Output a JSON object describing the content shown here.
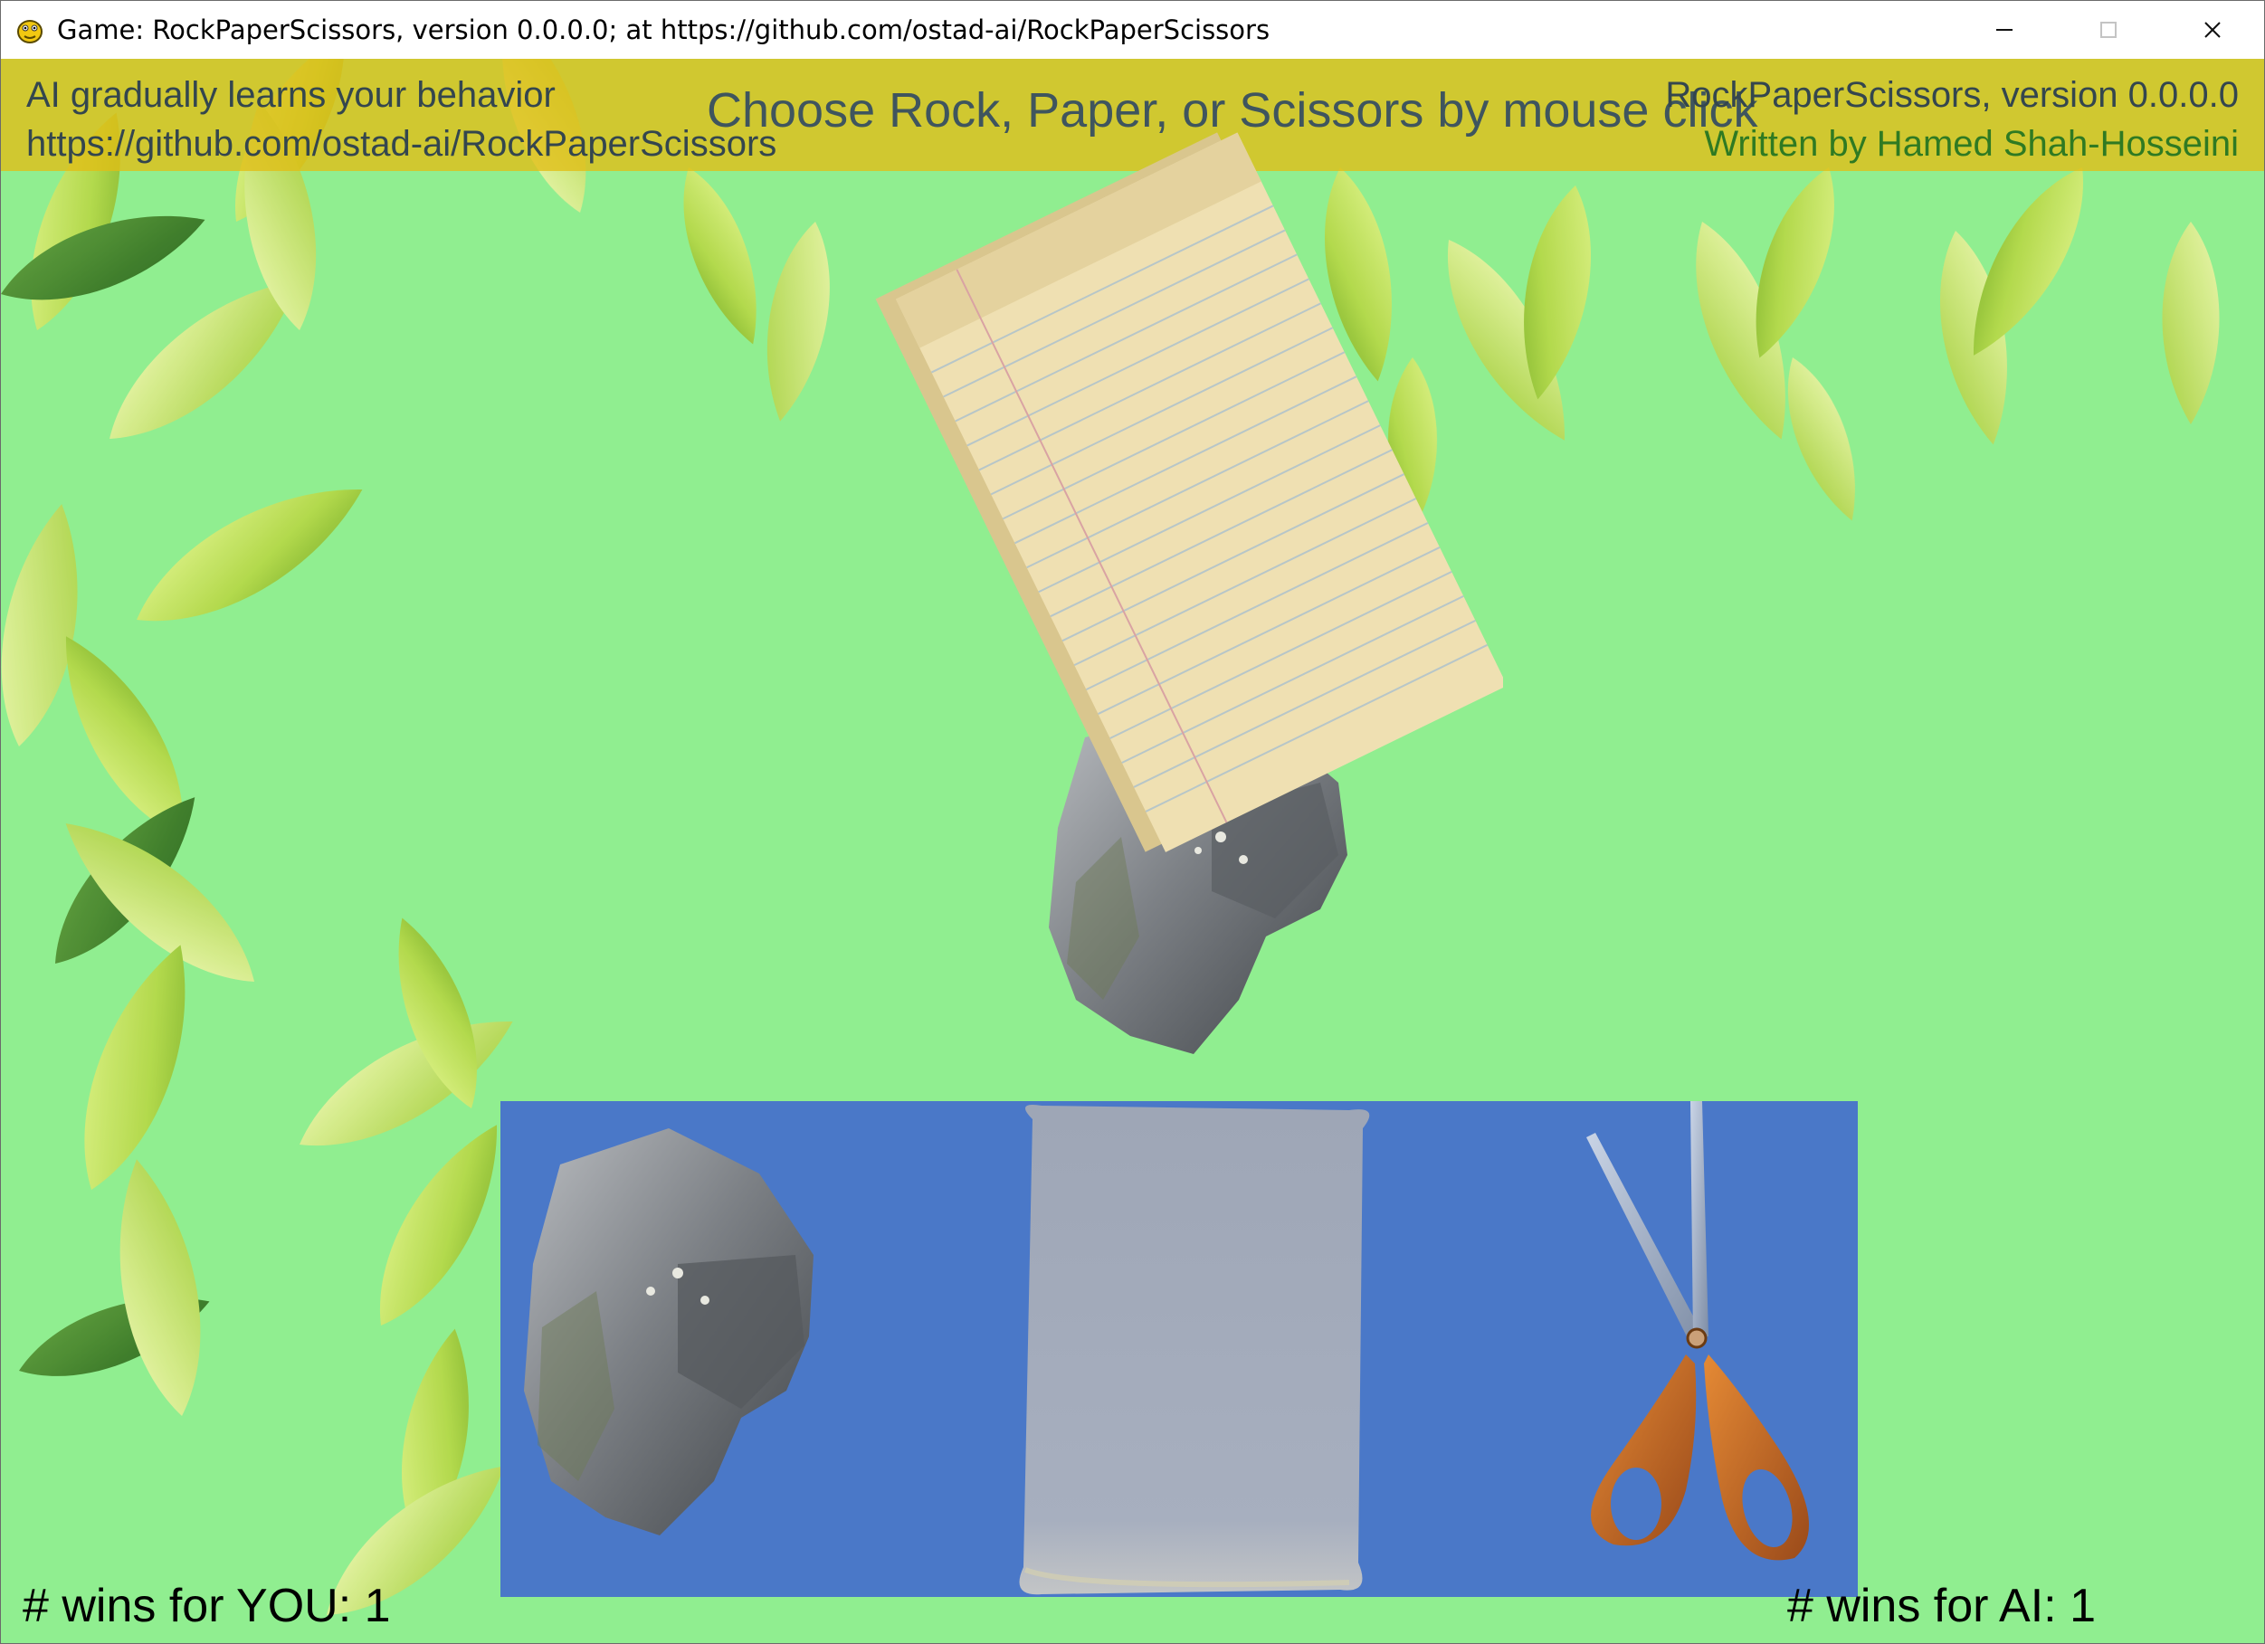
{
  "window": {
    "title": "Game: RockPaperScissors, version 0.0.0.0; at https://github.com/ostad-ai/RockPaperScissors",
    "icon": "pygame-snake-icon",
    "controls": [
      "minimize-icon",
      "maximize-icon",
      "close-icon"
    ]
  },
  "banner": {
    "left_line1": "AI gradually learns your behavior",
    "left_line2": "https://github.com/ostad-ai/RockPaperScissors",
    "center": "Choose Rock, Paper, or Scissors by mouse click",
    "right_line1": "RockPaperScissors, version 0.0.0.0",
    "right_line2": "Written by Hamed Shah-Hosseini"
  },
  "board": {
    "played": [
      "rock",
      "paper"
    ],
    "choices": [
      "rock",
      "paper",
      "scissors"
    ]
  },
  "scores": {
    "you": "# wins for YOU: 1",
    "ai": "# wins for AI: 1"
  },
  "colors": {
    "canvas_bg": "#90ee90",
    "banner_bg": "#e2be14",
    "choice_panel_bg": "#4a78c8",
    "author_text": "#2f7a22"
  }
}
